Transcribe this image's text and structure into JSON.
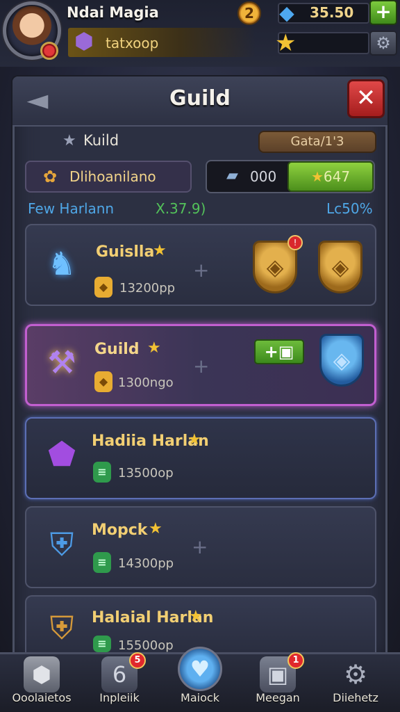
{
  "hud": {
    "player_name": "Ndai Magia",
    "level": "2",
    "gems": "35.50",
    "plus_label": "+",
    "guild_chip": "tatxoop"
  },
  "panel": {
    "title": "Guild",
    "close_label": "✕",
    "rank_label": "Kuild",
    "rank_pill": "Gata/1'3",
    "name_field": "Dlihoanilano",
    "count_value": "000",
    "star_value": "647",
    "sub_left": "Few Harlann",
    "sub_mid": "X.37.9)",
    "sub_right": "Lc50%"
  },
  "rows": [
    {
      "title": "Guislla",
      "sub": "13200pp"
    },
    {
      "title": "Guild",
      "sub": "1300ngo"
    },
    {
      "title": "Hadiia Harlan",
      "sub": "13500op"
    },
    {
      "title": "Mopck",
      "sub": "14300pp"
    },
    {
      "title": "Halaial Harlan",
      "sub": "15500op"
    }
  ],
  "nav": [
    {
      "label": "Ooolaietos",
      "badge": ""
    },
    {
      "label": "Inpleiik",
      "badge": "5"
    },
    {
      "label": "Maiock",
      "badge": ""
    },
    {
      "label": "Meegan",
      "badge": "1"
    },
    {
      "label": "Diiehetz",
      "badge": ""
    }
  ],
  "colors": {
    "accent_gold": "#f2cf73",
    "panel_bg": "#2c3042",
    "selected_row_border": "#c25fd0",
    "close_red": "#d63a3a",
    "green_button": "#6dbb3b"
  }
}
